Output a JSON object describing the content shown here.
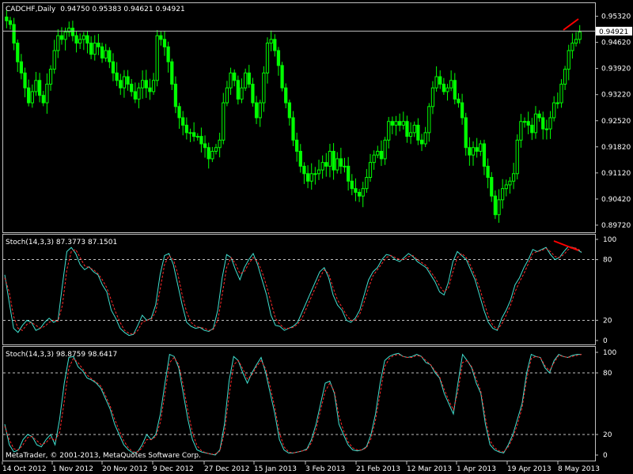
{
  "chart_data": [
    {
      "type": "candlestick",
      "title": "CADCHF,Daily",
      "ohlc_header": "0.94750 0.95383 0.94621 0.94921",
      "symbol": "CADCHF",
      "timeframe": "Daily",
      "current_price": "0.94921",
      "current_price_value": 0.94921,
      "ylim": [
        0.8955,
        0.9565
      ],
      "y_ticks": [
        "0.95320",
        "0.94620",
        "0.93920",
        "0.93220",
        "0.92520",
        "0.91820",
        "0.91120",
        "0.90420",
        "0.89720"
      ],
      "x_ticks": [
        "14 Oct 2012",
        "1 Nov 2012",
        "20 Nov 2012",
        "9 Dec 2012",
        "27 Dec 2012",
        "15 Jan 2013",
        "3 Feb 2013",
        "21 Feb 2013",
        "12 Mar 2013",
        "1 Apr 2013",
        "19 Apr 2013",
        "8 May 2013"
      ],
      "close_series": [
        0.952,
        0.951,
        0.946,
        0.941,
        0.938,
        0.934,
        0.93,
        0.933,
        0.936,
        0.932,
        0.93,
        0.935,
        0.939,
        0.944,
        0.948,
        0.947,
        0.949,
        0.95,
        0.948,
        0.946,
        0.947,
        0.948,
        0.946,
        0.943,
        0.946,
        0.945,
        0.942,
        0.944,
        0.941,
        0.938,
        0.936,
        0.934,
        0.937,
        0.935,
        0.933,
        0.931,
        0.934,
        0.936,
        0.934,
        0.933,
        0.936,
        0.948,
        0.947,
        0.945,
        0.941,
        0.935,
        0.929,
        0.926,
        0.924,
        0.922,
        0.922,
        0.921,
        0.921,
        0.919,
        0.918,
        0.915,
        0.917,
        0.918,
        0.92,
        0.93,
        0.934,
        0.938,
        0.936,
        0.931,
        0.934,
        0.938,
        0.935,
        0.93,
        0.926,
        0.93,
        0.938,
        0.946,
        0.947,
        0.944,
        0.94,
        0.934,
        0.93,
        0.926,
        0.92,
        0.917,
        0.913,
        0.911,
        0.909,
        0.911,
        0.911,
        0.912,
        0.914,
        0.913,
        0.917,
        0.912,
        0.915,
        0.913,
        0.913,
        0.909,
        0.907,
        0.906,
        0.905,
        0.907,
        0.91,
        0.914,
        0.916,
        0.917,
        0.915,
        0.92,
        0.925,
        0.924,
        0.925,
        0.924,
        0.925,
        0.921,
        0.922,
        0.924,
        0.92,
        0.919,
        0.922,
        0.929,
        0.934,
        0.937,
        0.935,
        0.933,
        0.934,
        0.936,
        0.931,
        0.93,
        0.926,
        0.918,
        0.916,
        0.918,
        0.917,
        0.919,
        0.913,
        0.91,
        0.905,
        0.9,
        0.904,
        0.907,
        0.908,
        0.909,
        0.911,
        0.92,
        0.925,
        0.925,
        0.924,
        0.922,
        0.927,
        0.926,
        0.923,
        0.923,
        0.926,
        0.93,
        0.93,
        0.935,
        0.939,
        0.944,
        0.946,
        0.947,
        0.949
      ]
    },
    {
      "type": "line",
      "title": "Stoch(14,3,3) 87.3773 87.1501",
      "ylim": [
        0,
        100
      ],
      "y_ticks": [
        "100",
        "80",
        "20",
        "0"
      ],
      "levels": [
        80,
        20
      ],
      "series": [
        {
          "name": "Stoch main",
          "color": "#40e0d0",
          "values": [
            65,
            38,
            12,
            8,
            15,
            20,
            18,
            10,
            12,
            18,
            22,
            18,
            20,
            55,
            88,
            92,
            86,
            75,
            70,
            73,
            68,
            65,
            55,
            48,
            30,
            22,
            12,
            8,
            5,
            6,
            15,
            25,
            20,
            22,
            35,
            65,
            84,
            86,
            75,
            55,
            35,
            18,
            14,
            12,
            13,
            10,
            9,
            12,
            30,
            62,
            85,
            82,
            70,
            60,
            72,
            80,
            86,
            75,
            60,
            45,
            25,
            15,
            14,
            10,
            12,
            14,
            18,
            28,
            38,
            48,
            58,
            68,
            72,
            62,
            45,
            35,
            30,
            20,
            18,
            22,
            30,
            45,
            60,
            68,
            72,
            80,
            85,
            84,
            80,
            78,
            82,
            86,
            83,
            78,
            75,
            72,
            65,
            58,
            48,
            45,
            58,
            78,
            88,
            84,
            80,
            70,
            60,
            45,
            30,
            18,
            12,
            10,
            22,
            30,
            40,
            55,
            62,
            72,
            80,
            90,
            88,
            90,
            92,
            85,
            80,
            82,
            88,
            93,
            92,
            90,
            87
          ]
        },
        {
          "name": "Stoch signal",
          "color": "#ff2a2a",
          "values": [
            62,
            48,
            24,
            12,
            10,
            16,
            18,
            15,
            12,
            14,
            18,
            20,
            19,
            35,
            70,
            88,
            90,
            82,
            74,
            72,
            70,
            66,
            60,
            52,
            40,
            28,
            18,
            10,
            7,
            6,
            10,
            18,
            20,
            21,
            28,
            50,
            75,
            84,
            80,
            66,
            45,
            28,
            18,
            14,
            13,
            12,
            10,
            11,
            20,
            45,
            72,
            82,
            76,
            66,
            68,
            76,
            82,
            78,
            68,
            54,
            38,
            22,
            16,
            12,
            12,
            13,
            16,
            22,
            32,
            42,
            52,
            62,
            70,
            66,
            52,
            40,
            33,
            25,
            20,
            20,
            26,
            38,
            52,
            64,
            70,
            76,
            82,
            84,
            82,
            80,
            80,
            83,
            84,
            80,
            77,
            74,
            68,
            62,
            54,
            48,
            52,
            68,
            82,
            86,
            82,
            74,
            64,
            52,
            38,
            24,
            15,
            11,
            16,
            25,
            35,
            48,
            58,
            66,
            76,
            86,
            88,
            89,
            91,
            88,
            83,
            82,
            85,
            90,
            92,
            91,
            88
          ]
        }
      ],
      "trendline_color": "#ff0000"
    },
    {
      "type": "line",
      "title": "Stoch(14,3,3) 98.8759 98.6417",
      "ylim": [
        0,
        100
      ],
      "y_ticks": [
        "100",
        "80",
        "20",
        "0"
      ],
      "levels": [
        80,
        20
      ],
      "series": [
        {
          "name": "Stoch main",
          "color": "#40e0d0",
          "values": [
            30,
            10,
            3,
            5,
            15,
            20,
            18,
            10,
            8,
            15,
            20,
            10,
            35,
            70,
            95,
            96,
            86,
            82,
            75,
            73,
            70,
            65,
            55,
            45,
            30,
            20,
            10,
            5,
            2,
            3,
            10,
            20,
            15,
            20,
            40,
            70,
            98,
            96,
            85,
            60,
            35,
            15,
            5,
            3,
            2,
            1,
            0,
            5,
            30,
            72,
            96,
            92,
            80,
            70,
            80,
            88,
            95,
            80,
            60,
            40,
            15,
            5,
            2,
            2,
            3,
            4,
            6,
            15,
            30,
            50,
            70,
            72,
            60,
            30,
            20,
            10,
            5,
            4,
            5,
            8,
            20,
            40,
            70,
            92,
            96,
            98,
            99,
            96,
            95,
            96,
            98,
            96,
            90,
            88,
            80,
            75,
            60,
            50,
            40,
            70,
            98,
            92,
            85,
            70,
            60,
            30,
            10,
            5,
            3,
            2,
            10,
            20,
            35,
            50,
            80,
            98,
            96,
            95,
            85,
            80,
            92,
            98,
            96,
            95,
            97,
            98,
            98
          ]
        },
        {
          "name": "Stoch signal",
          "color": "#ff2a2a",
          "values": [
            28,
            15,
            6,
            5,
            10,
            17,
            18,
            14,
            10,
            12,
            17,
            14,
            22,
            52,
            85,
            94,
            90,
            84,
            78,
            74,
            71,
            67,
            58,
            48,
            35,
            24,
            14,
            7,
            3,
            3,
            7,
            15,
            15,
            18,
            32,
            60,
            90,
            95,
            88,
            68,
            43,
            22,
            9,
            4,
            2,
            1,
            1,
            4,
            22,
            58,
            88,
            92,
            84,
            74,
            78,
            86,
            92,
            84,
            66,
            46,
            22,
            8,
            3,
            2,
            3,
            4,
            5,
            12,
            25,
            44,
            62,
            70,
            62,
            38,
            24,
            13,
            7,
            5,
            5,
            7,
            16,
            34,
            60,
            86,
            94,
            97,
            98,
            96,
            95,
            95,
            97,
            96,
            92,
            88,
            82,
            76,
            64,
            53,
            44,
            62,
            90,
            92,
            86,
            74,
            62,
            36,
            14,
            7,
            4,
            3,
            8,
            17,
            30,
            46,
            74,
            94,
            96,
            95,
            87,
            82,
            90,
            97,
            96,
            95,
            96,
            97,
            98
          ]
        }
      ]
    }
  ],
  "copyright": "MetaTrader, © 2001-2013, MetaQuotes Software Corp.",
  "colors": {
    "bull": "#00ff00",
    "bear": "#00ff00",
    "grid": "#808080",
    "border": "#c0c0c0",
    "background": "#000000"
  }
}
